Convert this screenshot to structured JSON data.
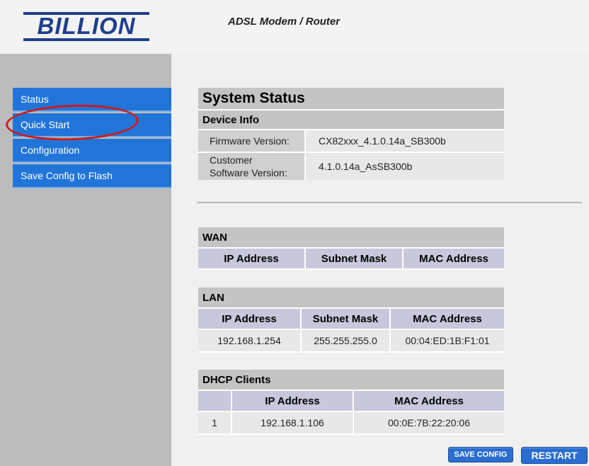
{
  "header": {
    "logo_text": "BILLION",
    "product_title": "ADSL Modem / Router"
  },
  "sidebar": {
    "items": [
      {
        "label": "Status"
      },
      {
        "label": "Quick Start"
      },
      {
        "label": "Configuration"
      },
      {
        "label": "Save Config to Flash"
      }
    ]
  },
  "main": {
    "title": "System Status",
    "device_info": {
      "heading": "Device Info",
      "firmware_label": "Firmware Version:",
      "firmware_value": "CX82xxx_4.1.0.14a_SB300b",
      "customer_label_line1": "Customer",
      "customer_label_line2": "Software Version:",
      "customer_value": "4.1.0.14a_AsSB300b"
    },
    "wan": {
      "heading": "WAN",
      "columns": [
        "IP Address",
        "Subnet Mask",
        "MAC Address"
      ]
    },
    "lan": {
      "heading": "LAN",
      "columns": [
        "IP Address",
        "Subnet Mask",
        "MAC Address"
      ],
      "row": [
        "192.168.1.254",
        "255.255.255.0",
        "00:04:ED:1B:F1:01"
      ]
    },
    "dhcp": {
      "heading": "DHCP Clients",
      "columns": [
        "IP Address",
        "MAC Address"
      ],
      "row": [
        "1",
        "192.168.1.106",
        "00:0E:7B:22:20:06"
      ]
    }
  },
  "buttons": {
    "save_config": "SAVE CONFIG",
    "restart": "RESTART"
  },
  "colors": {
    "brand": "#1e3f8c",
    "nav": "#2175d8",
    "annotation": "#cc1c1c"
  }
}
